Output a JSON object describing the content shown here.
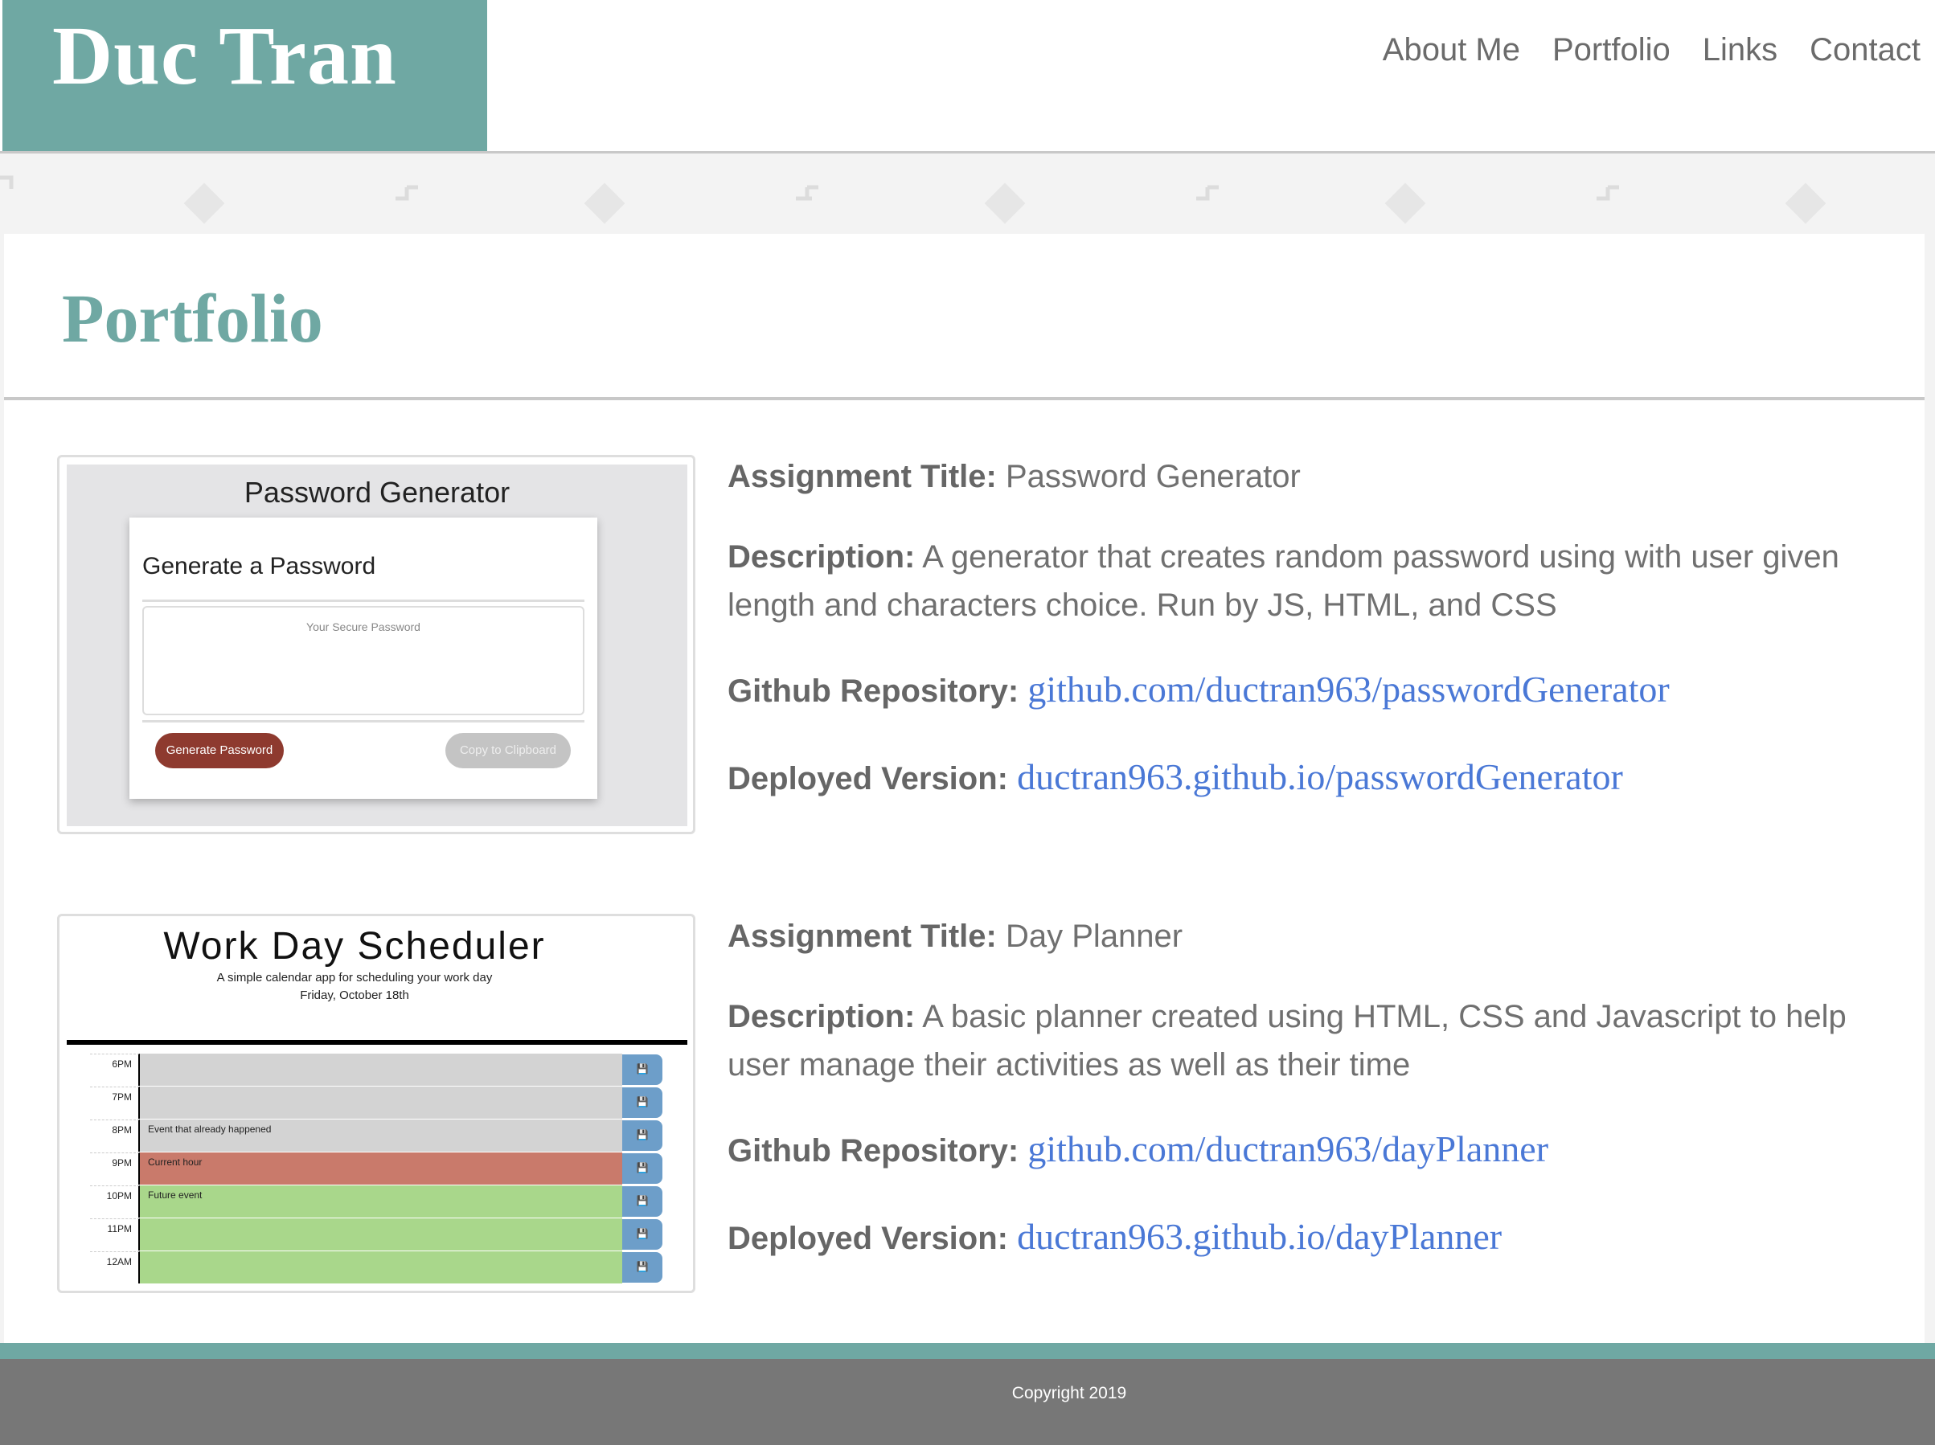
{
  "site": {
    "name": "Duc Tran",
    "nav": [
      "About Me",
      "Portfolio",
      "Links",
      "Contact"
    ]
  },
  "section_title": "Portfolio",
  "projects": [
    {
      "title_label": "Assignment Title:",
      "title": "Password Generator",
      "description_label": "Description:",
      "description": "A generator that creates random password using with user given length and characters choice. Run by JS, HTML, and CSS",
      "repo_label": "Github Repository:",
      "repo": "github.com/ductran963/passwordGenerator",
      "deployed_label": "Deployed Version:",
      "deployed": "ductran963.github.io/passwordGenerator",
      "thumbnail": {
        "title": "Password Generator",
        "heading": "Generate a Password",
        "placeholder": "Your Secure Password",
        "generate_button": "Generate Password",
        "copy_button": "Copy to Clipboard",
        "accent": "#8e3a2f"
      }
    },
    {
      "title_label": "Assignment Title:",
      "title": "Day Planner",
      "description_label": "Description:",
      "description": "A basic planner created using HTML, CSS and Javascript to help user manage their activities as well as their time",
      "repo_label": "Github Repository:",
      "repo": "github.com/ductran963/dayPlanner",
      "deployed_label": "Deployed Version:",
      "deployed": "ductran963.github.io/dayPlanner",
      "thumbnail": {
        "title": "Work Day Scheduler",
        "subtitle": "A simple calendar app for scheduling your work day",
        "date": "Friday, October 18th",
        "rows": [
          {
            "hour": "6PM",
            "text": "",
            "state": "past"
          },
          {
            "hour": "7PM",
            "text": "",
            "state": "past"
          },
          {
            "hour": "8PM",
            "text": "Event that already happened",
            "state": "past"
          },
          {
            "hour": "9PM",
            "text": "Current hour",
            "state": "present"
          },
          {
            "hour": "10PM",
            "text": "Future event",
            "state": "future"
          },
          {
            "hour": "11PM",
            "text": "",
            "state": "future"
          },
          {
            "hour": "12AM",
            "text": "",
            "state": "future"
          }
        ],
        "save_icon": "save-icon",
        "colors": {
          "past": "#d3d3d3",
          "present": "#c97a6b",
          "future": "#a9d78b",
          "save": "#6d9ec9"
        }
      }
    }
  ],
  "footer": {
    "copyright": "Copyright 2019"
  },
  "colors": {
    "brand": "#6fa8a3",
    "link": "#4a78d6",
    "footer": "#777777"
  }
}
